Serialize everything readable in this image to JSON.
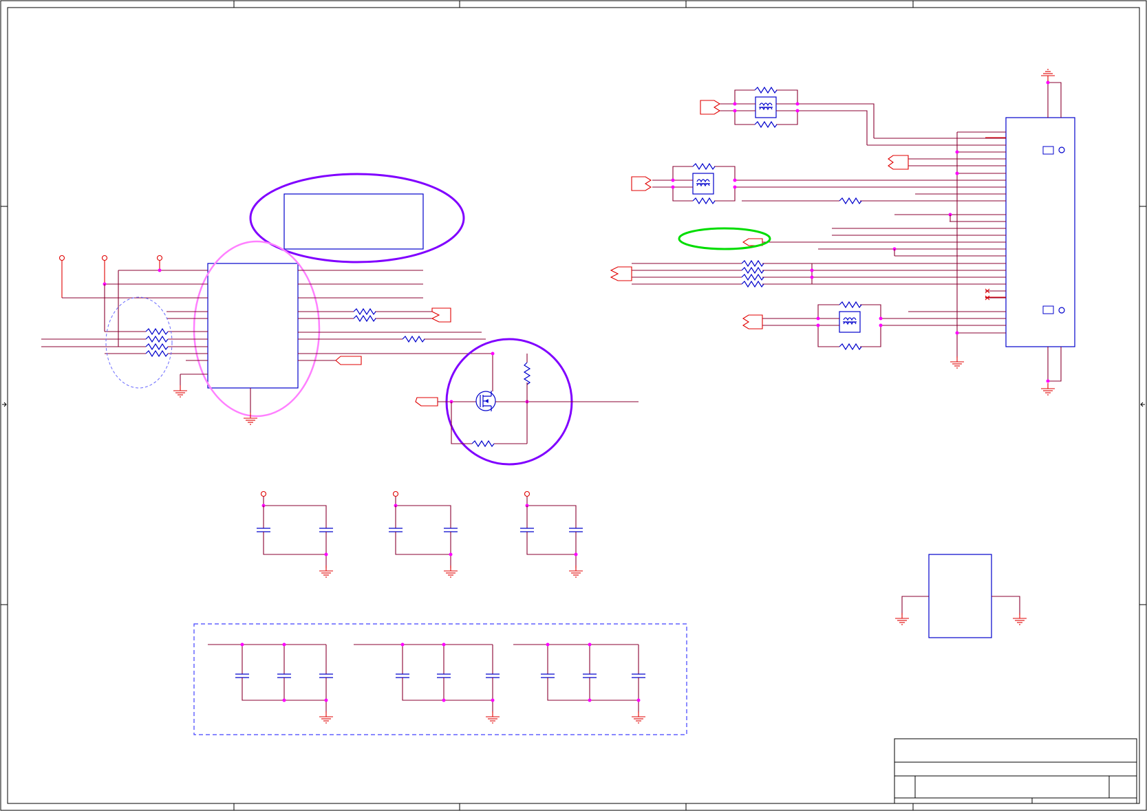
{
  "schematic": {
    "title_block": {
      "title": "",
      "sheet": "",
      "rev": ""
    },
    "highlights": [
      {
        "name": "purple-ellipse-header",
        "color": "#8000ff"
      },
      {
        "name": "pink-ellipse-ic",
        "color": "#ff80ff"
      },
      {
        "name": "purple-circle-mosfet",
        "color": "#8000ff"
      },
      {
        "name": "green-ellipse-port",
        "color": "#00dd00"
      }
    ],
    "colors": {
      "wire": "#8a0030",
      "pin": "#e00000",
      "component": "#0000cc",
      "junction": "#ff00ff"
    }
  }
}
